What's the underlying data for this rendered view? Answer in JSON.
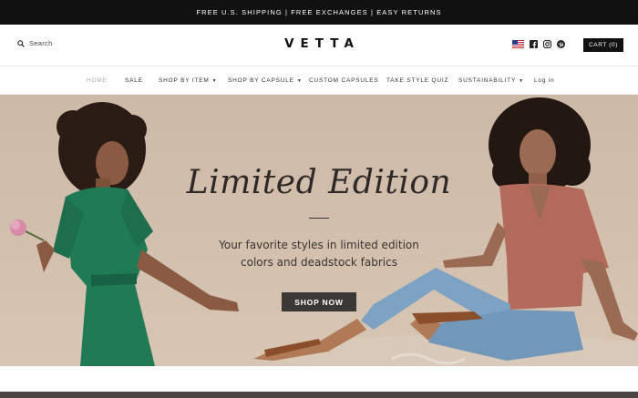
{
  "announcement": "FREE U.S. SHIPPING | FREE EXCHANGES | EASY RETURNS",
  "header": {
    "search_label": "Search",
    "logo": "VETTA",
    "cart_label": "CART (0)",
    "icons": [
      "us-flag-icon",
      "facebook-icon",
      "instagram-icon",
      "pinterest-icon"
    ]
  },
  "nav": {
    "items": [
      {
        "label": "HOME",
        "active": true
      },
      {
        "label": "SALE"
      },
      {
        "label": "SHOP BY ITEM",
        "has_dropdown": true
      },
      {
        "label": "SHOP BY CAPSULE",
        "has_dropdown": true
      },
      {
        "label": "CUSTOM CAPSULES"
      },
      {
        "label": "TAKE STYLE QUIZ"
      },
      {
        "label": "SUSTAINABILITY",
        "has_dropdown": true
      },
      {
        "label": "Log in"
      }
    ],
    "caret": "▼"
  },
  "hero": {
    "title": "Limited Edition",
    "subtitle_line1": "Your favorite styles in limited edition",
    "subtitle_line2": "colors and deadstock fabrics",
    "cta_label": "SHOP NOW"
  },
  "colors": {
    "announcement_bg": "#111111",
    "hero_bg": "#cfbba9",
    "cta_bg": "#3c3836",
    "green_dress": "#1f7a55",
    "rust_top": "#b46a5a",
    "denim": "#7ea2c4"
  }
}
